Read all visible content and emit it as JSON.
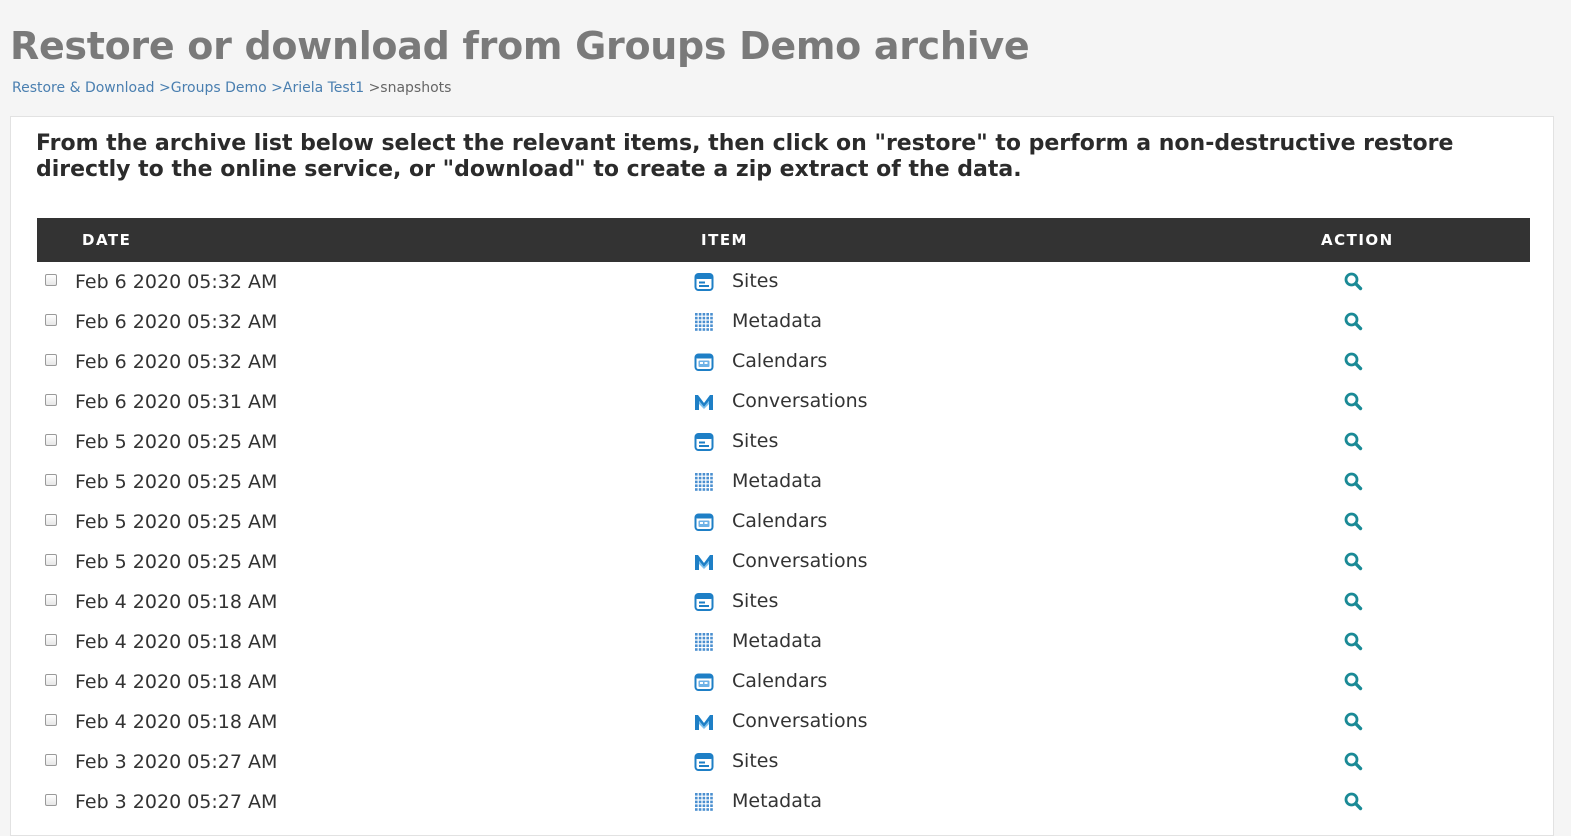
{
  "header": {
    "title": "Restore or download from Groups Demo archive"
  },
  "breadcrumb": [
    {
      "label": "Restore & Download",
      "link": true
    },
    {
      "label": ">Groups Demo",
      "link": true
    },
    {
      "label": ">Ariela Test1",
      "link": true
    },
    {
      "label": ">snapshots",
      "link": false
    }
  ],
  "instructions": "From the archive list below select the relevant items, then click on \"restore\" to perform a non-destructive restore directly to the online service, or \"download\" to create a zip extract of the data.",
  "table": {
    "columns": {
      "date": "DATE",
      "item": "ITEM",
      "action": "ACTION"
    },
    "rows": [
      {
        "date": "Feb 6 2020 05:32 AM",
        "item": "Sites",
        "icon": "sites-icon"
      },
      {
        "date": "Feb 6 2020 05:32 AM",
        "item": "Metadata",
        "icon": "metadata-icon"
      },
      {
        "date": "Feb 6 2020 05:32 AM",
        "item": "Calendars",
        "icon": "calendar-icon"
      },
      {
        "date": "Feb 6 2020 05:31 AM",
        "item": "Conversations",
        "icon": "mail-icon"
      },
      {
        "date": "Feb 5 2020 05:25 AM",
        "item": "Sites",
        "icon": "sites-icon"
      },
      {
        "date": "Feb 5 2020 05:25 AM",
        "item": "Metadata",
        "icon": "metadata-icon"
      },
      {
        "date": "Feb 5 2020 05:25 AM",
        "item": "Calendars",
        "icon": "calendar-icon"
      },
      {
        "date": "Feb 5 2020 05:25 AM",
        "item": "Conversations",
        "icon": "mail-icon"
      },
      {
        "date": "Feb 4 2020 05:18 AM",
        "item": "Sites",
        "icon": "sites-icon"
      },
      {
        "date": "Feb 4 2020 05:18 AM",
        "item": "Metadata",
        "icon": "metadata-icon"
      },
      {
        "date": "Feb 4 2020 05:18 AM",
        "item": "Calendars",
        "icon": "calendar-icon"
      },
      {
        "date": "Feb 4 2020 05:18 AM",
        "item": "Conversations",
        "icon": "mail-icon"
      },
      {
        "date": "Feb 3 2020 05:27 AM",
        "item": "Sites",
        "icon": "sites-icon"
      },
      {
        "date": "Feb 3 2020 05:27 AM",
        "item": "Metadata",
        "icon": "metadata-icon"
      }
    ],
    "action_icon": "search-icon"
  },
  "colors": {
    "title": "#7a7a7a",
    "link": "#4a7fb0",
    "header_bg": "#333333",
    "icon_blue": "#1e7fc6",
    "action_teal": "#1a8a96"
  }
}
